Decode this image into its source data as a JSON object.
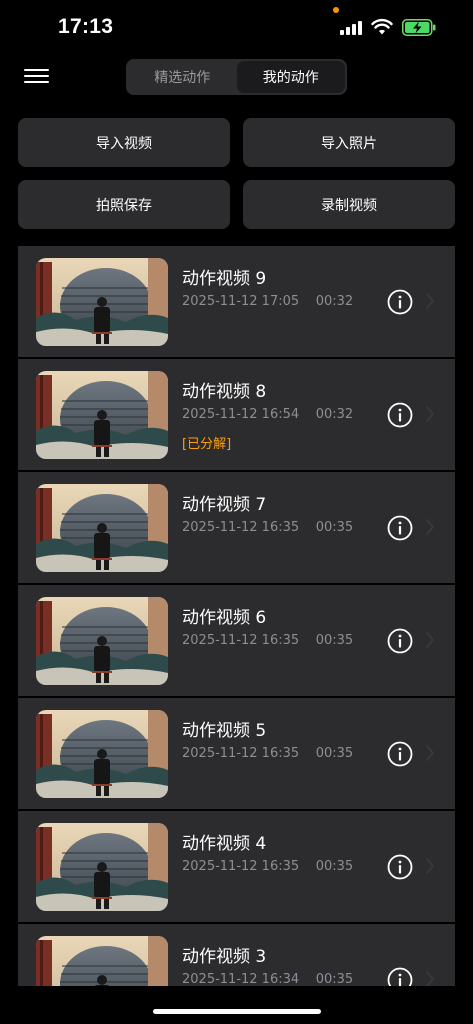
{
  "status_bar": {
    "time": "17:13"
  },
  "header": {
    "tabs": [
      {
        "label": "精选动作",
        "active": false
      },
      {
        "label": "我的动作",
        "active": true
      }
    ]
  },
  "actions": {
    "import_video": "导入视频",
    "import_photo": "导入照片",
    "take_photo": "拍照保存",
    "record_video": "录制视频"
  },
  "videos": [
    {
      "title": "动作视频 9",
      "date": "2025-11-12 17:05",
      "duration": "00:32",
      "badge": ""
    },
    {
      "title": "动作视频 8",
      "date": "2025-11-12 16:54",
      "duration": "00:32",
      "badge": "[已分解]"
    },
    {
      "title": "动作视频 7",
      "date": "2025-11-12 16:35",
      "duration": "00:35",
      "badge": ""
    },
    {
      "title": "动作视频 6",
      "date": "2025-11-12 16:35",
      "duration": "00:35",
      "badge": ""
    },
    {
      "title": "动作视频 5",
      "date": "2025-11-12 16:35",
      "duration": "00:35",
      "badge": ""
    },
    {
      "title": "动作视频 4",
      "date": "2025-11-12 16:35",
      "duration": "00:35",
      "badge": ""
    },
    {
      "title": "动作视频 3",
      "date": "2025-11-12 16:34",
      "duration": "00:35",
      "badge": ""
    }
  ],
  "colors": {
    "background": "#000000",
    "card": "#2c2c2e",
    "accent_badge": "#ff9f0a",
    "secondary_text": "#8e8e93"
  }
}
